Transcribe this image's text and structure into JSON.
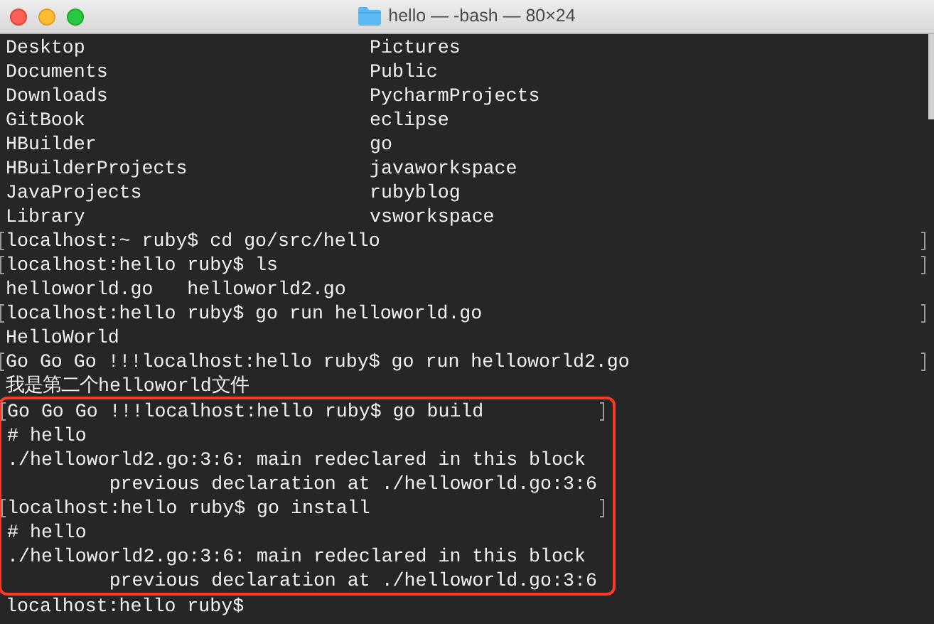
{
  "window": {
    "title": "hello — -bash — 80×24"
  },
  "lines": [
    {
      "cells": [
        "Desktop",
        "Pictures"
      ],
      "marked": false,
      "highlighted": false
    },
    {
      "cells": [
        "Documents",
        "Public"
      ],
      "marked": false,
      "highlighted": false
    },
    {
      "cells": [
        "Downloads",
        "PycharmProjects"
      ],
      "marked": false,
      "highlighted": false
    },
    {
      "cells": [
        "GitBook",
        "eclipse"
      ],
      "marked": false,
      "highlighted": false
    },
    {
      "cells": [
        "HBuilder",
        "go"
      ],
      "marked": false,
      "highlighted": false
    },
    {
      "cells": [
        "HBuilderProjects",
        "javaworkspace"
      ],
      "marked": false,
      "highlighted": false
    },
    {
      "cells": [
        "JavaProjects",
        "rubyblog"
      ],
      "marked": false,
      "highlighted": false
    },
    {
      "cells": [
        "Library",
        "vsworkspace"
      ],
      "marked": false,
      "highlighted": false
    },
    {
      "cells": [
        "localhost:~ ruby$ cd go/src/hello"
      ],
      "marked": true,
      "highlighted": false
    },
    {
      "cells": [
        "localhost:hello ruby$ ls"
      ],
      "marked": true,
      "highlighted": false
    },
    {
      "cells": [
        "helloworld.go   helloworld2.go"
      ],
      "marked": false,
      "highlighted": false
    },
    {
      "cells": [
        "localhost:hello ruby$ go run helloworld.go"
      ],
      "marked": true,
      "highlighted": false
    },
    {
      "cells": [
        "HelloWorld"
      ],
      "marked": false,
      "highlighted": false
    },
    {
      "cells": [
        "Go Go Go !!!localhost:hello ruby$ go run helloworld2.go"
      ],
      "marked": true,
      "highlighted": false
    },
    {
      "cells": [
        "我是第二个helloworld文件"
      ],
      "marked": false,
      "highlighted": false
    },
    {
      "cells": [
        "Go Go Go !!!localhost:hello ruby$ go build"
      ],
      "marked": true,
      "highlighted": true
    },
    {
      "cells": [
        "# hello"
      ],
      "marked": false,
      "highlighted": true
    },
    {
      "cells": [
        "./helloworld2.go:3:6: main redeclared in this block"
      ],
      "marked": false,
      "highlighted": true
    },
    {
      "cells": [
        "         previous declaration at ./helloworld.go:3:6"
      ],
      "marked": false,
      "highlighted": true
    },
    {
      "cells": [
        "localhost:hello ruby$ go install"
      ],
      "marked": true,
      "highlighted": true
    },
    {
      "cells": [
        "# hello"
      ],
      "marked": false,
      "highlighted": true
    },
    {
      "cells": [
        "./helloworld2.go:3:6: main redeclared in this block"
      ],
      "marked": false,
      "highlighted": true
    },
    {
      "cells": [
        "         previous declaration at ./helloworld.go:3:6"
      ],
      "marked": false,
      "highlighted": true
    },
    {
      "cells": [
        "localhost:hello ruby$"
      ],
      "marked": false,
      "highlighted": false
    }
  ]
}
